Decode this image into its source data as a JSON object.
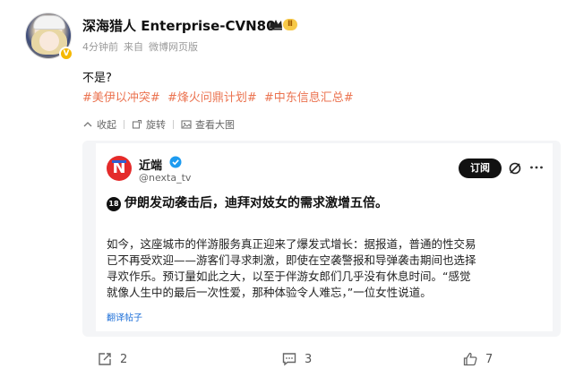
{
  "post": {
    "username": "深海猎人 Enterprise-CVN80",
    "level": "Ⅱ",
    "verified_mark": "V",
    "time": "4分钟前",
    "source_prefix": "来自",
    "source": "微博网页版",
    "text": "不是?",
    "hashtags": [
      "#美伊以冲突#",
      "#烽火问鼎计划#",
      "#中东信息汇总#"
    ],
    "actions": {
      "collapse": "收起",
      "rotate": "旋转",
      "view_large": "查看大图"
    }
  },
  "tweet": {
    "name": "近端",
    "handle": "@nexta_tv",
    "subscribe": "订阅",
    "age_badge": "18",
    "headline": "伊朗发动袭击后，迪拜对妓女的需求激增五倍。",
    "body_lines": [
      "如今，这座城市的伴游服务真正迎来了爆发式增长：据报道，普通的性交易",
      "已不再受欢迎——游客们寻求刺激，即使在空袭警报和导弹袭击期间也选择",
      "寻欢作乐。预订量如此之大，以至于伴游女郎们几乎没有休息时间。“感觉",
      "就像人生中的最后一次性爱，那种体验令人难忘，”一位女性说道。"
    ],
    "translate": "翻译帖子"
  },
  "footer": {
    "reposts": "2",
    "comments": "3",
    "likes": "7"
  },
  "colors": {
    "hashtag": "#eb7350",
    "repost_bg": "#f4f5f7",
    "subscribe_bg": "#111111",
    "translate_link": "#1d6fd8"
  }
}
